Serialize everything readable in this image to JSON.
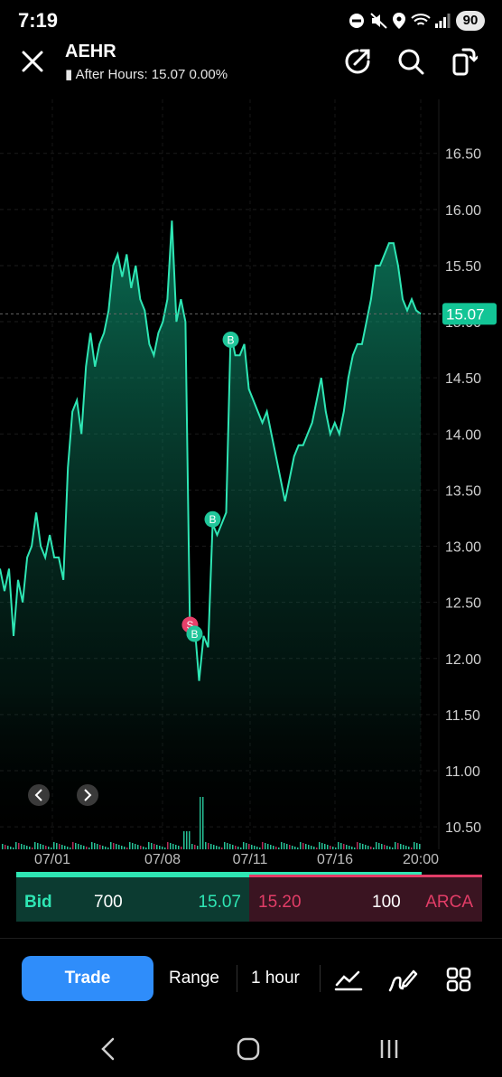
{
  "status_bar": {
    "time": "7:19",
    "battery": "90"
  },
  "header": {
    "symbol": "AEHR",
    "subtitle": "After Hours: 15.07 0.00%"
  },
  "chart_data": {
    "type": "area",
    "series": [
      {
        "values": [
          12.8,
          12.6,
          12.8,
          12.2,
          12.7,
          12.5,
          12.9,
          13.0,
          13.3,
          13.0,
          12.9,
          13.1,
          12.9,
          12.9,
          12.7,
          13.7,
          14.2,
          14.3,
          14.0,
          14.6,
          14.9,
          14.6,
          14.8,
          14.9,
          15.1,
          15.5,
          15.6,
          15.4,
          15.6,
          15.3,
          15.5,
          15.2,
          15.1,
          14.8,
          14.7,
          14.9,
          15.0,
          15.2,
          15.9,
          15.0,
          15.2,
          15.0,
          12.2,
          12.3,
          11.8,
          12.2,
          12.1,
          13.2,
          13.1,
          13.2,
          13.3,
          14.9,
          14.7,
          14.7,
          14.8,
          14.4,
          14.3,
          14.2,
          14.1,
          14.2,
          14.0,
          13.8,
          13.6,
          13.4,
          13.6,
          13.8,
          13.9,
          13.9,
          14.0,
          14.1,
          14.3,
          14.5,
          14.2,
          14.0,
          14.1,
          14.0,
          14.2,
          14.5,
          14.7,
          14.8,
          14.8,
          15.0,
          15.2,
          15.5,
          15.5,
          15.6,
          15.7,
          15.7,
          15.5,
          15.2,
          15.1,
          15.2,
          15.1,
          15.07
        ]
      }
    ],
    "x_tick_labels": [
      "07/01",
      "07/08",
      "07/11",
      "07/16",
      "20:00"
    ],
    "y_tick_labels": [
      "16.50",
      "16.00",
      "15.50",
      "15.00",
      "14.50",
      "14.00",
      "13.50",
      "13.00",
      "12.50",
      "12.00",
      "11.50",
      "11.00",
      "10.50"
    ],
    "ylim": [
      10.3,
      16.9
    ],
    "last_price_label": "15.07",
    "markers": [
      {
        "label": "S",
        "type": "sell",
        "index": 42,
        "value": 12.3
      },
      {
        "label": "B",
        "type": "buy",
        "index": 43,
        "value": 12.22
      },
      {
        "label": "B",
        "type": "buy",
        "index": 47,
        "value": 13.24
      },
      {
        "label": "B",
        "type": "buy",
        "index": 51,
        "value": 14.84
      }
    ],
    "grid": true,
    "colors": {
      "line": "#2ee6b4",
      "buy_marker": "#20c69a",
      "sell_marker": "#e8406a",
      "price_tag": "#13c596"
    }
  },
  "chart_nav": {
    "prev_icon": "chevron-left-icon",
    "next_icon": "chevron-right-icon"
  },
  "quote_bar": {
    "bid_label": "Bid",
    "bid_size": "700",
    "bid_price": "15.07",
    "ask_price": "15.20",
    "ask_size": "100",
    "exchange": "ARCA"
  },
  "toolbar": {
    "trade_label": "Trade",
    "range_label": "Range",
    "interval_label": "1 hour",
    "indicator_icon": "indicator-icon",
    "draw_icon": "draw-icon",
    "grid_icon": "grid-icon"
  },
  "nav_bar": {
    "back_icon": "back-icon",
    "home_icon": "home-icon",
    "recents_icon": "recents-icon"
  },
  "colors": {
    "accent_blue": "#2f8dfa",
    "bid_green": "#2ee6b4",
    "ask_red": "#e23d67"
  }
}
